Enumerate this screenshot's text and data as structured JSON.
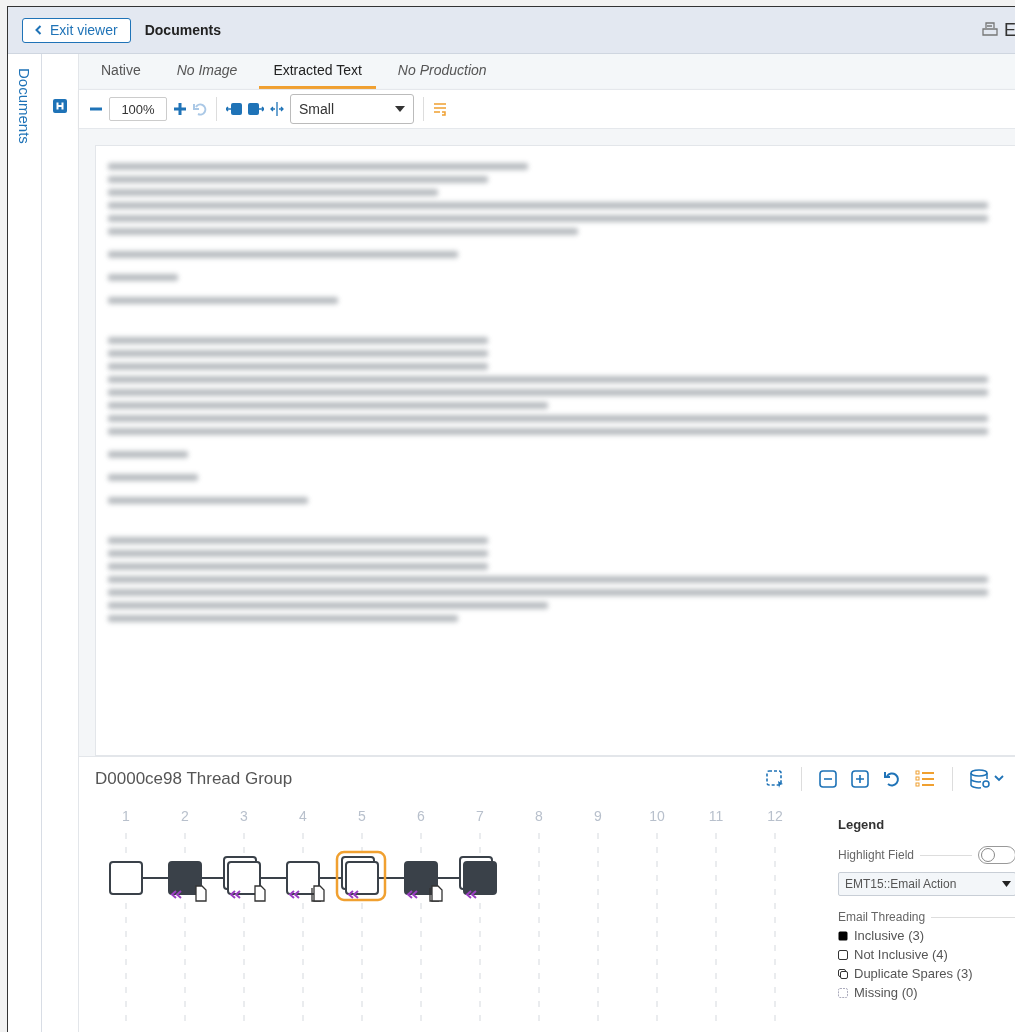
{
  "header": {
    "exit_label": "Exit viewer",
    "title": "Documents",
    "action_label": "E"
  },
  "sidebar": {
    "label": "Documents"
  },
  "tabs": [
    {
      "label": "Native",
      "selected": false,
      "available": true
    },
    {
      "label": "No Image",
      "selected": false,
      "available": false
    },
    {
      "label": "Extracted Text",
      "selected": true,
      "available": true
    },
    {
      "label": "No Production",
      "selected": false,
      "available": false
    }
  ],
  "toolbar": {
    "zoom": "100%",
    "size": "Small"
  },
  "thread": {
    "title": "D0000ce98 Thread Group",
    "columns": [
      "1",
      "2",
      "3",
      "4",
      "5",
      "6",
      "7",
      "8",
      "9",
      "10",
      "11",
      "12"
    ],
    "nodes": [
      {
        "kind": "not_inclusive",
        "duplicate": false,
        "reply": false,
        "attachment": false,
        "selected": false
      },
      {
        "kind": "inclusive",
        "duplicate": false,
        "reply": true,
        "attachment": true,
        "multiple_attachments": false,
        "selected": false
      },
      {
        "kind": "not_inclusive",
        "duplicate": true,
        "reply": true,
        "attachment": true,
        "multiple_attachments": false,
        "selected": false
      },
      {
        "kind": "not_inclusive",
        "duplicate": false,
        "reply": true,
        "attachment": true,
        "multiple_attachments": true,
        "selected": false
      },
      {
        "kind": "not_inclusive",
        "duplicate": true,
        "reply": true,
        "attachment": false,
        "selected": true
      },
      {
        "kind": "inclusive",
        "duplicate": false,
        "reply": true,
        "attachment": true,
        "multiple_attachments": true,
        "selected": false
      },
      {
        "kind": "inclusive",
        "duplicate": true,
        "reply": true,
        "attachment": false,
        "selected": false
      }
    ]
  },
  "legend": {
    "title": "Legend",
    "highlight_label": "Highlight Field",
    "highlight_on": false,
    "field": "EMT15::Email Action",
    "section": "Email Threading",
    "items": [
      {
        "kind": "inclusive",
        "label": "Inclusive (3)"
      },
      {
        "kind": "not_inclusive",
        "label": "Not Inclusive (4)"
      },
      {
        "kind": "duplicate",
        "label": "Duplicate Spares (3)"
      },
      {
        "kind": "missing",
        "label": "Missing (0)"
      }
    ]
  }
}
